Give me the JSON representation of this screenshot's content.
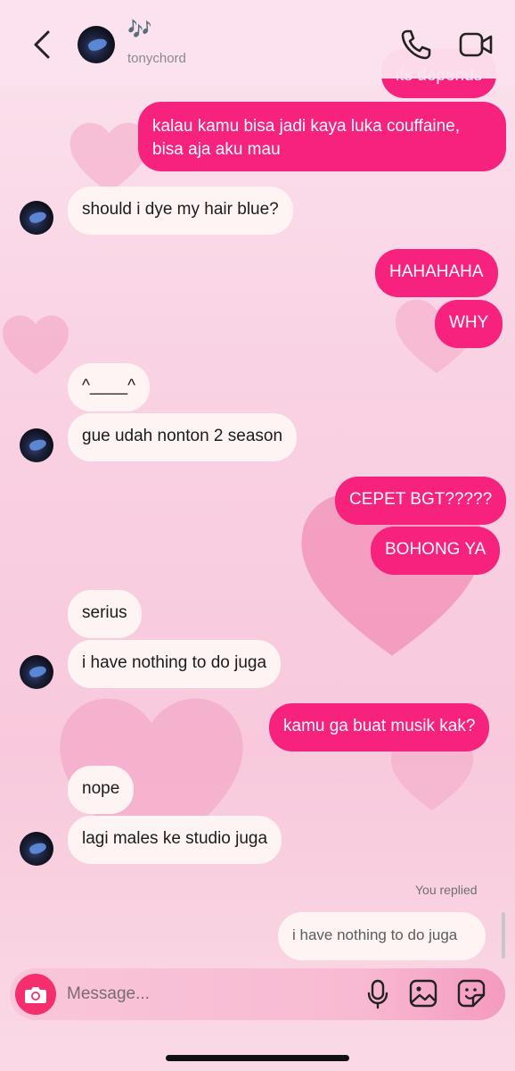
{
  "header": {
    "title": "🎶",
    "username": "tonychord"
  },
  "messages": {
    "partial_top": "its depends",
    "m1": "kalau kamu bisa jadi kaya luka couffaine,",
    "m1b": "bisa aja aku mau",
    "m2": "should i dye my hair blue?",
    "m3": "HAHAHAHA",
    "m4": "WHY",
    "m5": "^____^",
    "m6": "gue udah nonton 2 season",
    "m7": "CEPET BGT?????",
    "m8": "BOHONG YA",
    "m9": "serius",
    "m10": "i have nothing to do juga",
    "m11": "kamu ga buat musik kak?",
    "m12": "nope",
    "m13": "lagi males ke studio juga"
  },
  "reply": {
    "label": "You replied",
    "quoted": "i have nothing to do juga"
  },
  "composer": {
    "placeholder": "Message..."
  },
  "colors": {
    "outgoing_bubble": "#f7217e",
    "incoming_bubble": "#fdf4f3",
    "camera_button": "#f52f6e"
  },
  "icons": [
    "back-icon",
    "phone-icon",
    "video-camera-icon",
    "camera-icon",
    "microphone-icon",
    "gallery-icon",
    "sticker-icon"
  ]
}
